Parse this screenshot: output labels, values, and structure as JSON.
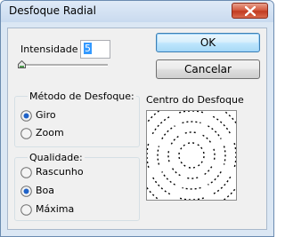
{
  "window": {
    "title": "Desfoque Radial"
  },
  "intensity": {
    "label": "Intensidade",
    "value": "5",
    "slider_level": 0.05
  },
  "buttons": {
    "ok": "OK",
    "cancel": "Cancelar"
  },
  "method": {
    "legend": "Método de Desfoque:",
    "options": [
      {
        "label": "Giro",
        "selected": true
      },
      {
        "label": "Zoom",
        "selected": false
      }
    ]
  },
  "quality": {
    "legend": "Qualidade:",
    "options": [
      {
        "label": "Rascunho",
        "selected": false
      },
      {
        "label": "Boa",
        "selected": true
      },
      {
        "label": "Máxima",
        "selected": false
      }
    ]
  },
  "center": {
    "label": "Centro do Desfoque"
  },
  "icons": {
    "close": "close-icon"
  },
  "colors": {
    "selection": "#3399ff",
    "ok_border": "#3c7fb1",
    "close_red": "#c23b21"
  }
}
